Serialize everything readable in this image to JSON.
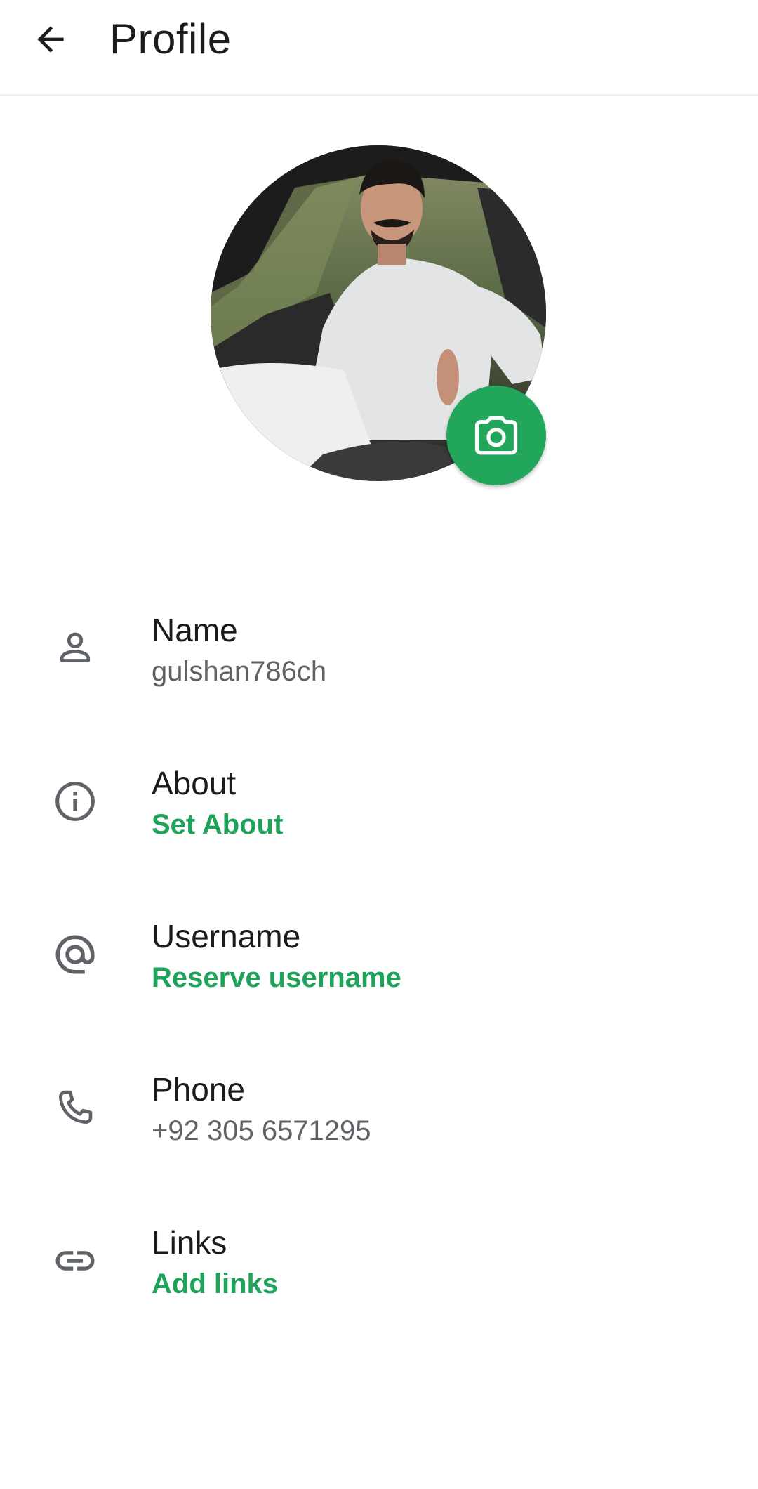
{
  "appbar": {
    "back_icon": "arrow-left-icon",
    "title": "Profile"
  },
  "avatar": {
    "camera_icon": "camera-icon",
    "accent_color": "#21a65c"
  },
  "rows": [
    {
      "icon": "person-icon",
      "label": "Name",
      "value": "gulshan786ch"
    },
    {
      "icon": "info-icon",
      "label": "About",
      "value": "Set About"
    },
    {
      "icon": "at-sign-icon",
      "label": "Username",
      "value": "Reserve username"
    },
    {
      "icon": "phone-icon",
      "label": "Phone",
      "value": "+92 305 6571295"
    },
    {
      "icon": "link-icon",
      "label": "Links",
      "value": "Add links"
    }
  ],
  "colors": {
    "accent": "#1fa35b",
    "icon": "#5f6368",
    "secondary_text": "#5e6266"
  }
}
